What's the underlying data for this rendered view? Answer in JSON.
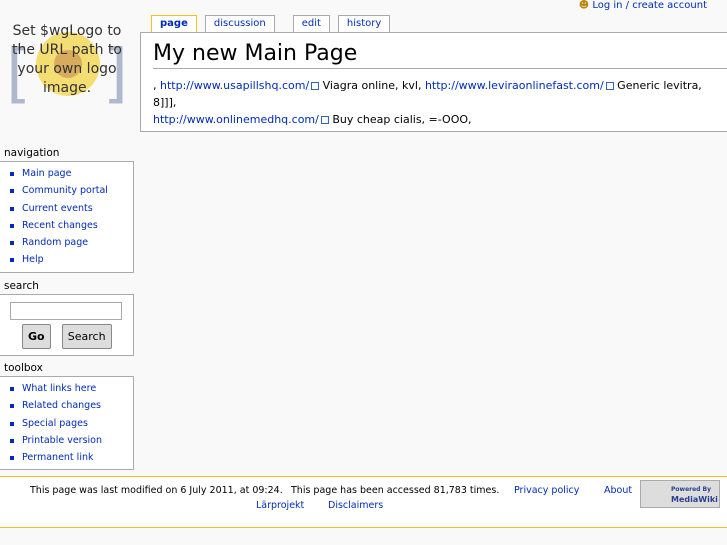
{
  "logo": {
    "text": "Set $wgLogo to the URL path to your own logo image."
  },
  "personal": {
    "login": "Log in / create account"
  },
  "tabs": [
    {
      "label": "page"
    },
    {
      "label": "discussion"
    },
    {
      "label": "edit"
    },
    {
      "label": "history"
    }
  ],
  "content": {
    "title": "My new Main Page",
    "parts": [
      ", ",
      "http://www.usapillshq.com/",
      " Viagra online, kvl, ",
      "http://www.leviraonlinefast.com/",
      " Generic levitra, 8]]], ",
      "http://www.onlinemedhq.com/",
      " Buy cheap cialis, =-OOO,"
    ]
  },
  "navigation": {
    "title": "navigation",
    "items": [
      "Main page",
      "Community portal",
      "Current events",
      "Recent changes",
      "Random page",
      "Help"
    ]
  },
  "search": {
    "title": "search",
    "go": "Go",
    "search": "Search",
    "value": ""
  },
  "toolbox": {
    "title": "toolbox",
    "items": [
      "What links here",
      "Related changes",
      "Special pages",
      "Printable version",
      "Permanent link"
    ]
  },
  "footer": {
    "modified": "This page was last modified on 6 July 2011, at 09:24.",
    "accessed": "This page has been accessed 81,783 times.",
    "privacy": "Privacy policy",
    "about": "About",
    "larprojekt": "Lärprojekt",
    "disclaimers": "Disclaimers",
    "powered_top": "Powered By",
    "powered": "MediaWiki"
  }
}
